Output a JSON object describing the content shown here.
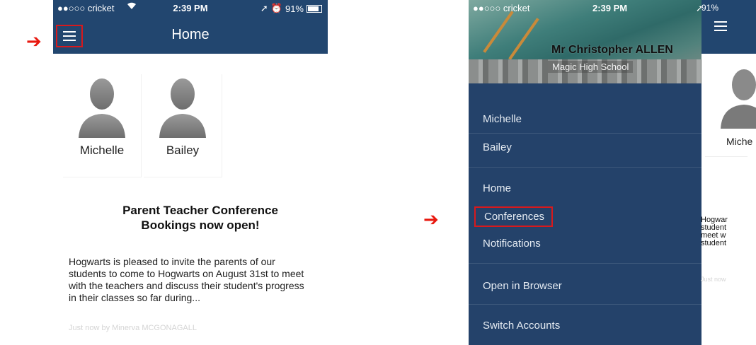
{
  "annotation": {
    "arrow_color": "#e8180f",
    "highlight_color": "#d8191c"
  },
  "left": {
    "status": {
      "carrier": "●●○○○ cricket",
      "wifi_icon": "wifi-icon",
      "time": "2:39 PM",
      "battery": "91%"
    },
    "header": {
      "title": "Home",
      "menu_icon": "hamburger-menu-icon",
      "bar_color": "#22466f"
    },
    "students": [
      {
        "name": "Michelle"
      },
      {
        "name": "Bailey"
      }
    ],
    "news": {
      "title_line1": "Parent Teacher Conference",
      "title_line2": "Bookings now open!",
      "body": "Hogwarts is pleased to invite the parents of our students to come to Hogwarts on August 31st to meet with the teachers and discuss their student's progress in their classes so far during...",
      "meta": "Just now by Minerva MCGONAGALL"
    }
  },
  "right": {
    "status": {
      "carrier": "●●○○○ cricket",
      "time": "2:39 PM",
      "battery": "91%"
    },
    "drawer": {
      "user_name": "Mr Christopher ALLEN",
      "school": "Magic High School",
      "students": [
        "Michelle",
        "Bailey"
      ],
      "menu": [
        "Home",
        "Conferences",
        "Notifications",
        "Open in Browser",
        "Switch Accounts"
      ],
      "highlighted_item": "Conferences",
      "background_color": "#24426a"
    },
    "peek": {
      "student_name": "Miche",
      "text_lines": [
        "Hogwar",
        "student",
        "meet w",
        "student"
      ],
      "meta": "Just now"
    }
  }
}
